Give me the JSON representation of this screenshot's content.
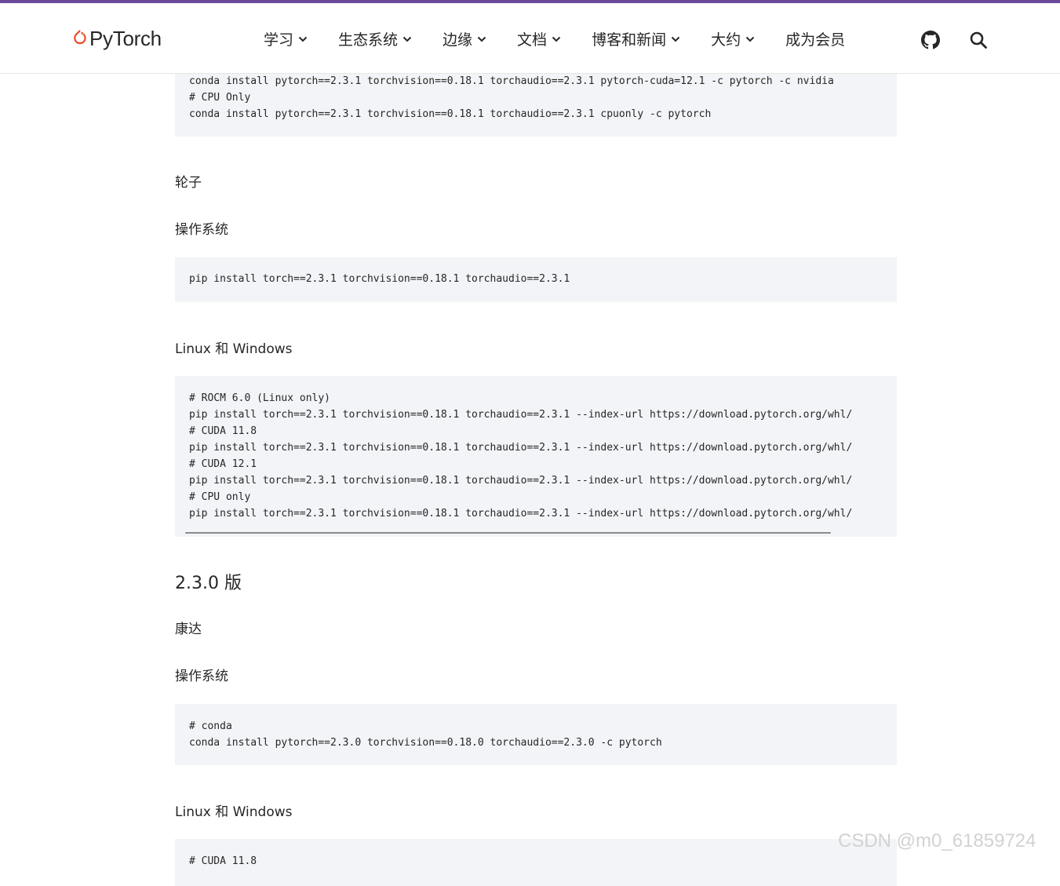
{
  "colors": {
    "accent": "#6c4a9a",
    "logo": "#ee4c2c",
    "code_bg": "#f3f4f7"
  },
  "header": {
    "logo_text": "PyTorch",
    "nav": [
      {
        "label": "学习",
        "has_dropdown": true
      },
      {
        "label": "生态系统",
        "has_dropdown": true
      },
      {
        "label": "边缘",
        "has_dropdown": true
      },
      {
        "label": "文档",
        "has_dropdown": true
      },
      {
        "label": "博客和新闻",
        "has_dropdown": true
      },
      {
        "label": "大约",
        "has_dropdown": true
      },
      {
        "label": "成为会员",
        "has_dropdown": false
      }
    ],
    "icons": [
      "github-icon",
      "search-icon"
    ]
  },
  "sections": {
    "conda_block_top": [
      "conda install pytorch==2.3.1 torchvision==0.18.1 torchaudio==2.3.1 pytorch-cuda=12.1 -c pytorch -c nvidia",
      "# CPU Only",
      "conda install pytorch==2.3.1 torchvision==0.18.1 torchaudio==2.3.1 cpuonly -c pytorch"
    ],
    "wheel_heading": "轮子",
    "os_heading_1": "操作系统",
    "pip_osx_block": [
      "pip install torch==2.3.1 torchvision==0.18.1 torchaudio==2.3.1"
    ],
    "linux_windows_heading_1": "Linux 和 Windows",
    "pip_linux_block": [
      "# ROCM 6.0 (Linux only)",
      "pip install torch==2.3.1 torchvision==0.18.1 torchaudio==2.3.1 --index-url https://download.pytorch.org/whl/",
      "# CUDA 11.8",
      "pip install torch==2.3.1 torchvision==0.18.1 torchaudio==2.3.1 --index-url https://download.pytorch.org/whl/",
      "# CUDA 12.1",
      "pip install torch==2.3.1 torchvision==0.18.1 torchaudio==2.3.1 --index-url https://download.pytorch.org/whl/",
      "# CPU only",
      "pip install torch==2.3.1 torchvision==0.18.1 torchaudio==2.3.1 --index-url https://download.pytorch.org/whl/"
    ],
    "version_heading": "2.3.0 版",
    "conda_heading": "康达",
    "os_heading_2": "操作系统",
    "conda_230_block": [
      "# conda",
      "conda install pytorch==2.3.0 torchvision==0.18.0 torchaudio==2.3.0 -c pytorch"
    ],
    "linux_windows_heading_2": "Linux 和 Windows",
    "bottom_block": [
      "# CUDA 11.8"
    ]
  },
  "watermark": "CSDN @m0_61859724"
}
